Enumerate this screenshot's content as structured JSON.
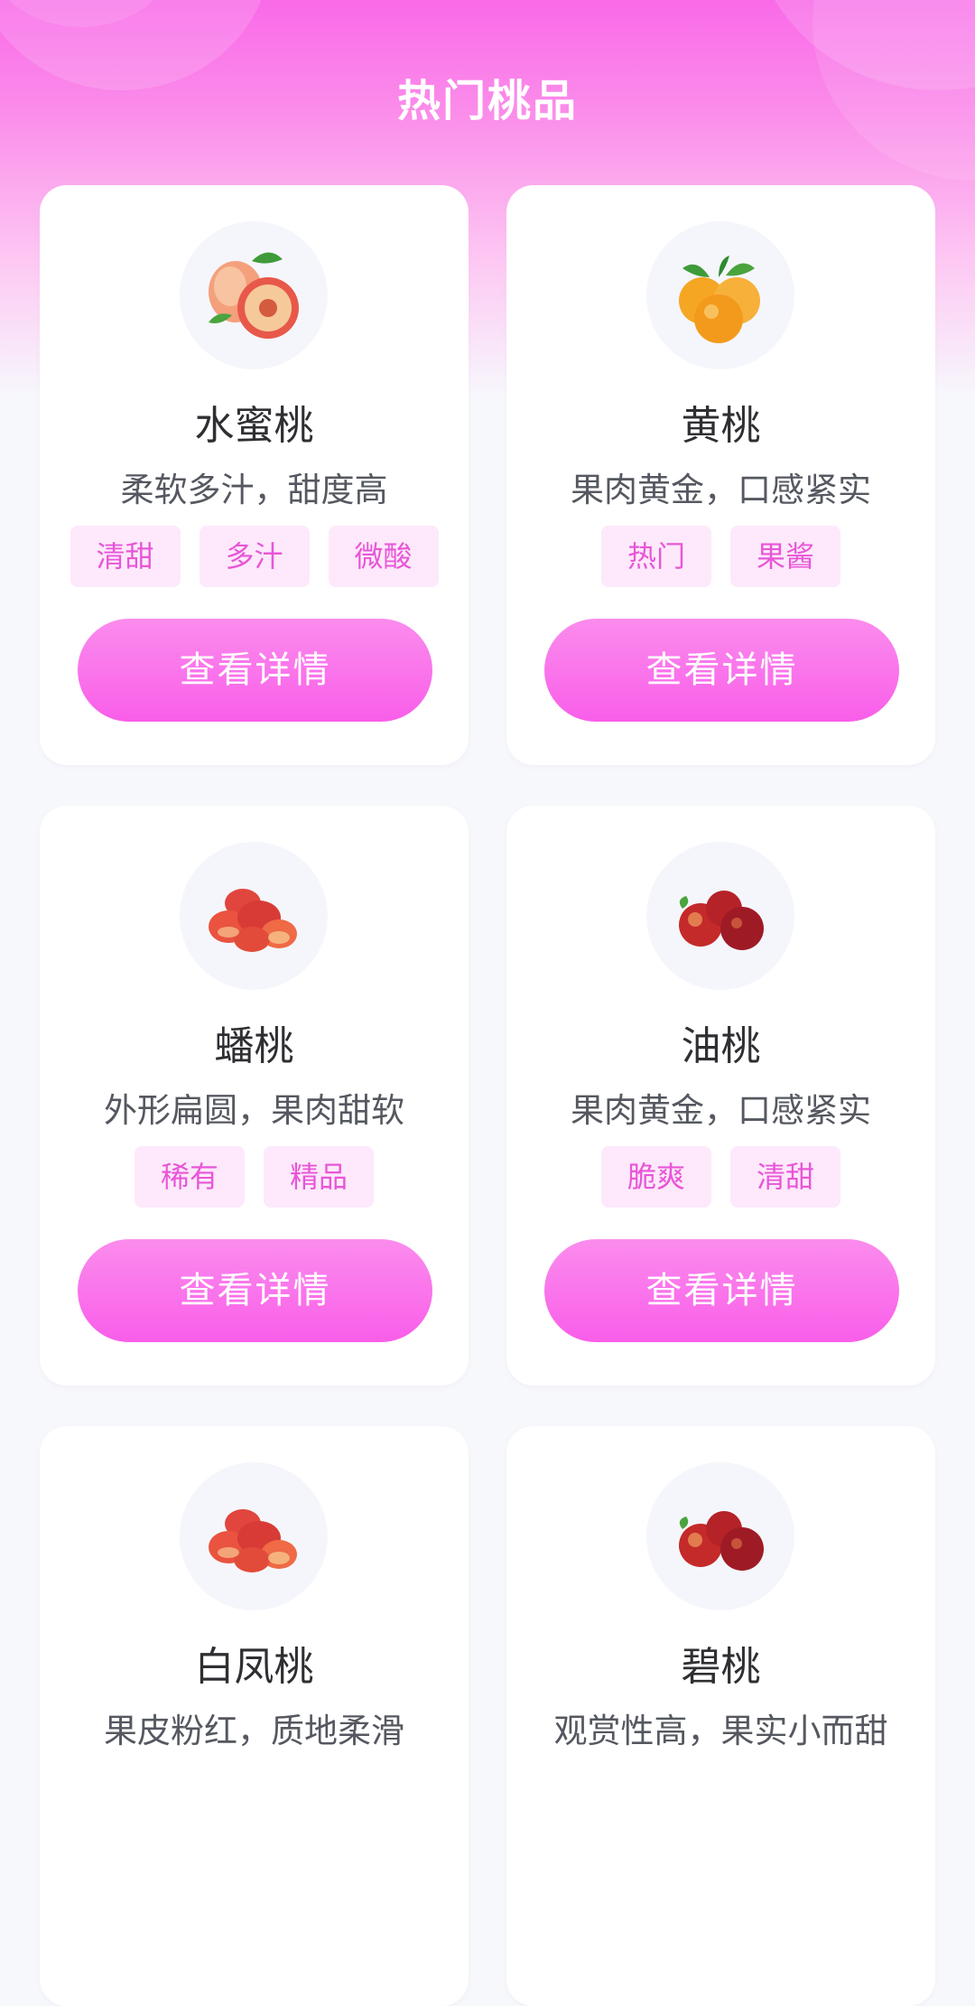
{
  "header": {
    "title": "热门桃品"
  },
  "colors": {
    "accent": "#f95ee9",
    "tag_bg": "#fde9fb",
    "tag_text": "#e856d8"
  },
  "button_label": "查看详情",
  "products": [
    {
      "name": "水蜜桃",
      "desc": "柔软多汁，甜度高",
      "tags": [
        "清甜",
        "多汁",
        "微酸"
      ],
      "icon": "peach-icon"
    },
    {
      "name": "黄桃",
      "desc": "果肉黄金，口感紧实",
      "tags": [
        "热门",
        "果酱"
      ],
      "icon": "yellow-peach-icon"
    },
    {
      "name": "蟠桃",
      "desc": "外形扁圆，果肉甜软",
      "tags": [
        "稀有",
        "精品"
      ],
      "icon": "flat-peach-icon"
    },
    {
      "name": "油桃",
      "desc": "果肉黄金，口感紧实",
      "tags": [
        "脆爽",
        "清甜"
      ],
      "icon": "nectarine-icon"
    },
    {
      "name": "白凤桃",
      "desc": "果皮粉红，质地柔滑",
      "tags": [],
      "icon": "flat-peach-icon"
    },
    {
      "name": "碧桃",
      "desc": "观赏性高，果实小而甜",
      "tags": [],
      "icon": "nectarine-icon"
    }
  ]
}
